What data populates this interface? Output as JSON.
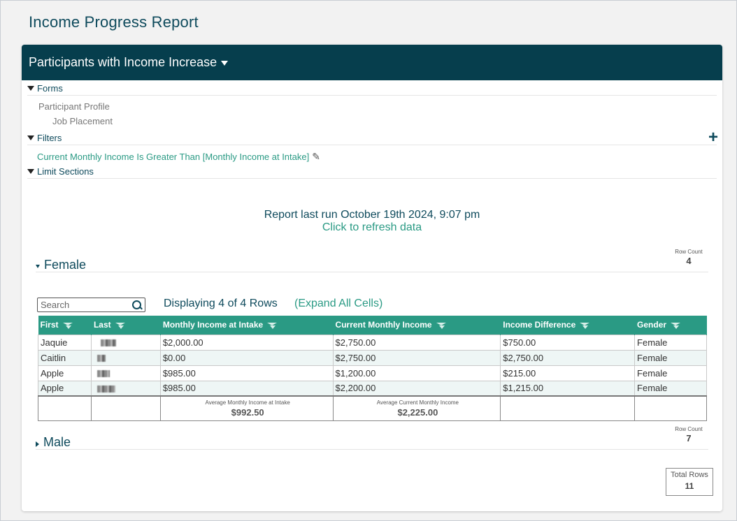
{
  "page_title": "Income Progress Report",
  "card_title": "Participants with Income Increase",
  "sections": {
    "forms": {
      "label": "Forms",
      "items": [
        "Participant Profile",
        "Job Placement"
      ]
    },
    "filters": {
      "label": "Filters",
      "filter_text": "Current Monthly Income Is Greater Than [Monthly Income at Intake]"
    },
    "limit_sections": {
      "label": "Limit Sections"
    }
  },
  "report_run": {
    "text": "Report last run October 19th 2024, 9:07 pm",
    "refresh": "Click to refresh data"
  },
  "groups": {
    "female": {
      "label": "Female",
      "row_count_label": "Row Count",
      "row_count": "4",
      "search_placeholder": "Search",
      "display_text": "Displaying 4 of 4 Rows",
      "expand_text": "(Expand All Cells)",
      "columns": [
        "First",
        "Last",
        "Monthly Income at Intake",
        "Current Monthly Income",
        "Income Difference",
        "Gender"
      ],
      "rows": [
        {
          "first": "Jaquie",
          "last": "",
          "intake": "$2,000.00",
          "current": "$2,750.00",
          "diff": "$750.00",
          "gender": "Female"
        },
        {
          "first": "Caitlin",
          "last": "",
          "intake": "$0.00",
          "current": "$2,750.00",
          "diff": "$2,750.00",
          "gender": "Female"
        },
        {
          "first": "Apple",
          "last": "",
          "intake": "$985.00",
          "current": "$1,200.00",
          "diff": "$215.00",
          "gender": "Female"
        },
        {
          "first": "Apple",
          "last": "",
          "intake": "$985.00",
          "current": "$2,200.00",
          "diff": "$1,215.00",
          "gender": "Female"
        }
      ],
      "summary": {
        "intake_label": "Average Monthly Income at Intake",
        "intake_value": "$992.50",
        "current_label": "Average Current Monthly Income",
        "current_value": "$2,225.00"
      }
    },
    "male": {
      "label": "Male",
      "row_count_label": "Row Count",
      "row_count": "7"
    }
  },
  "total_rows": {
    "label": "Total Rows",
    "value": "11"
  },
  "colors": {
    "header_bg": "#063e4d",
    "table_header": "#2a9a84",
    "link": "#2a9a84",
    "title": "#0e4a5c"
  }
}
